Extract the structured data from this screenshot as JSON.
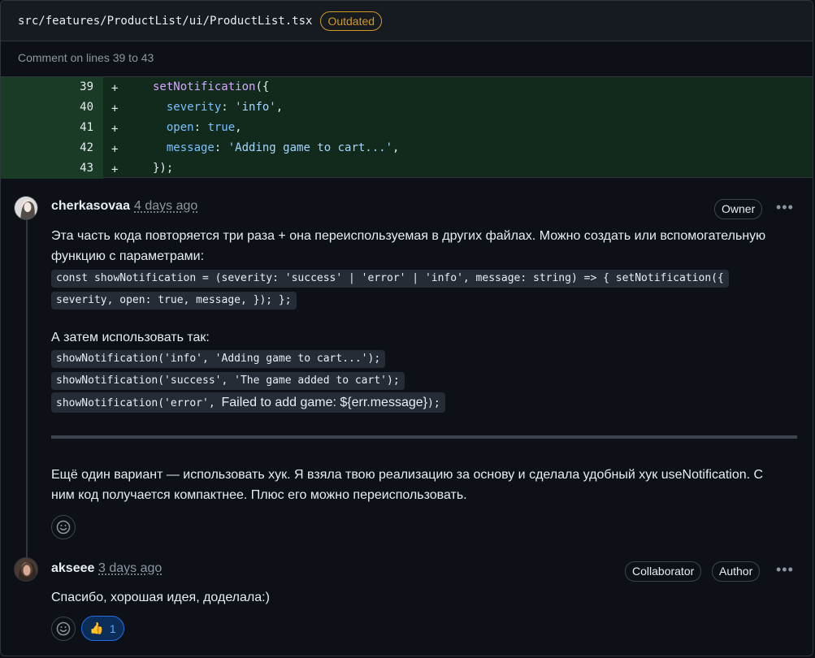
{
  "file": {
    "path": "src/features/ProductList/ui/ProductList.tsx",
    "status": "Outdated",
    "comment_range": "Comment on lines 39 to 43"
  },
  "diff": {
    "lines": [
      {
        "num": "39",
        "sign": "+",
        "indent": "",
        "parts": [
          {
            "t": "setNotification",
            "c": "fn"
          },
          {
            "t": "({",
            "c": "punc"
          }
        ]
      },
      {
        "num": "40",
        "sign": "+",
        "indent": "  ",
        "parts": [
          {
            "t": "severity",
            "c": "prop"
          },
          {
            "t": ": ",
            "c": "punc"
          },
          {
            "t": "'info'",
            "c": "str"
          },
          {
            "t": ",",
            "c": "punc"
          }
        ]
      },
      {
        "num": "41",
        "sign": "+",
        "indent": "  ",
        "parts": [
          {
            "t": "open",
            "c": "prop"
          },
          {
            "t": ": ",
            "c": "punc"
          },
          {
            "t": "true",
            "c": "kw"
          },
          {
            "t": ",",
            "c": "punc"
          }
        ]
      },
      {
        "num": "42",
        "sign": "+",
        "indent": "  ",
        "parts": [
          {
            "t": "message",
            "c": "prop"
          },
          {
            "t": ": ",
            "c": "punc"
          },
          {
            "t": "'Adding game to cart...'",
            "c": "str"
          },
          {
            "t": ",",
            "c": "punc"
          }
        ]
      },
      {
        "num": "43",
        "sign": "+",
        "indent": "",
        "parts": [
          {
            "t": "});",
            "c": "punc"
          }
        ]
      }
    ]
  },
  "comments": [
    {
      "author": "cherkasovaa",
      "time": "4 days ago",
      "badges": [
        "Owner"
      ],
      "para1": "Эта часть кода повторяется три раза + она переиспользуемая в других файлах. Можно создать или вспомогательную функцию с параметрами:",
      "code1_line1": "const showNotification = (severity: 'success' | 'error' | 'info', message: string) => { setNotification({",
      "code1_line2": "severity, open: true, message, }); };",
      "para2": "А затем использовать так:",
      "code2": "showNotification('info', 'Adding game to cart...');",
      "code3": "showNotification('success', 'The game added to cart');",
      "code4_a": "showNotification('error', ",
      "code4_b": "Failed to add game: ${err.message}",
      "code4_c": ");",
      "para3": "Ещё один вариант — использовать хук. Я взяла твою реализацию за основу и сделала удобный хук useNotification. С ним код получается компактнее. Плюс его можно переиспользовать."
    },
    {
      "author": "akseee",
      "time": "3 days ago",
      "badges": [
        "Collaborator",
        "Author"
      ],
      "text": "Спасибо, хорошая идея, доделала:)",
      "reaction_emoji": "👍",
      "reaction_count": "1"
    }
  ],
  "icons": {
    "more": "kebab-horizontal-icon",
    "reaction": "smiley-icon"
  }
}
